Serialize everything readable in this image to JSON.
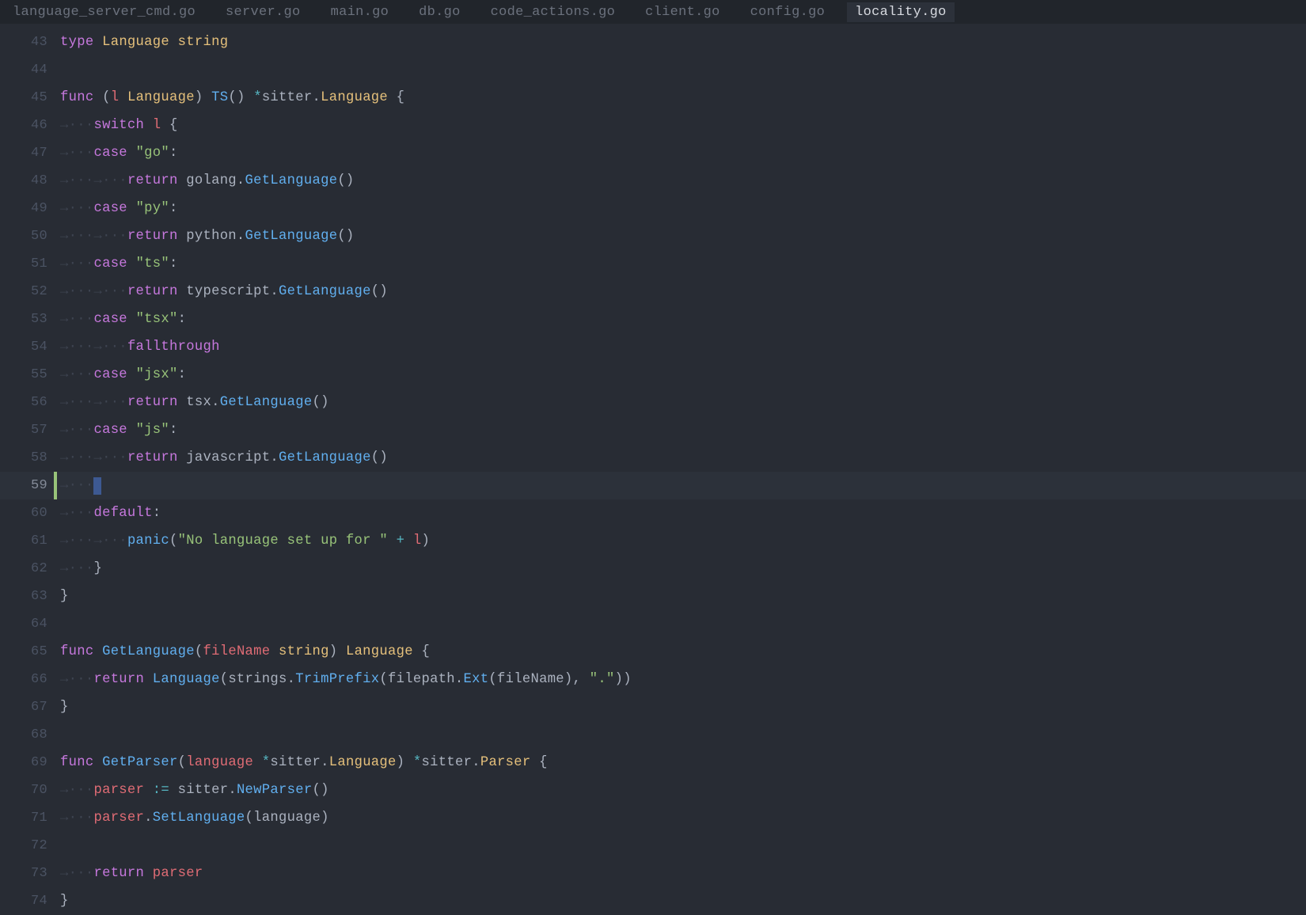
{
  "tabs": [
    {
      "label": "language_server_cmd.go",
      "active": false
    },
    {
      "label": "server.go",
      "active": false
    },
    {
      "label": "main.go",
      "active": false
    },
    {
      "label": "db.go",
      "active": false
    },
    {
      "label": "code_actions.go",
      "active": false
    },
    {
      "label": "client.go",
      "active": false
    },
    {
      "label": "config.go",
      "active": false
    },
    {
      "label": "locality.go",
      "active": true
    }
  ],
  "ws_arrow": "→",
  "ws_dot": "·",
  "lines": [
    {
      "n": 43,
      "mod": "",
      "ind": 0,
      "cur": false,
      "tokens": [
        [
          "kw",
          "type"
        ],
        [
          "pl",
          " "
        ],
        [
          "yl",
          "Language"
        ],
        [
          "pl",
          " "
        ],
        [
          "yl",
          "string"
        ]
      ]
    },
    {
      "n": 44,
      "mod": "",
      "ind": 0,
      "cur": false,
      "tokens": []
    },
    {
      "n": 45,
      "mod": "",
      "ind": 0,
      "cur": false,
      "tokens": [
        [
          "kw",
          "func"
        ],
        [
          "pl",
          " ("
        ],
        [
          "red",
          "l"
        ],
        [
          "pl",
          " "
        ],
        [
          "yl",
          "Language"
        ],
        [
          "pl",
          ") "
        ],
        [
          "fn",
          "TS"
        ],
        [
          "pl",
          "() "
        ],
        [
          "cy",
          "*"
        ],
        [
          "pl",
          "sitter."
        ],
        [
          "yl",
          "Language"
        ],
        [
          "pl",
          " {"
        ]
      ]
    },
    {
      "n": 46,
      "mod": "",
      "ind": 1,
      "cur": false,
      "tokens": [
        [
          "kw",
          "switch"
        ],
        [
          "pl",
          " "
        ],
        [
          "red",
          "l"
        ],
        [
          "pl",
          " {"
        ]
      ]
    },
    {
      "n": 47,
      "mod": "",
      "ind": 1,
      "cur": false,
      "tokens": [
        [
          "kw",
          "case"
        ],
        [
          "pl",
          " "
        ],
        [
          "gr",
          "\"go\""
        ],
        [
          "pl",
          ":"
        ]
      ]
    },
    {
      "n": 48,
      "mod": "",
      "ind": 2,
      "cur": false,
      "tokens": [
        [
          "kw",
          "return"
        ],
        [
          "pl",
          " golang."
        ],
        [
          "fn",
          "GetLanguage"
        ],
        [
          "pl",
          "()"
        ]
      ]
    },
    {
      "n": 49,
      "mod": "",
      "ind": 1,
      "cur": false,
      "tokens": [
        [
          "kw",
          "case"
        ],
        [
          "pl",
          " "
        ],
        [
          "gr",
          "\"py\""
        ],
        [
          "pl",
          ":"
        ]
      ]
    },
    {
      "n": 50,
      "mod": "",
      "ind": 2,
      "cur": false,
      "tokens": [
        [
          "kw",
          "return"
        ],
        [
          "pl",
          " python."
        ],
        [
          "fn",
          "GetLanguage"
        ],
        [
          "pl",
          "()"
        ]
      ]
    },
    {
      "n": 51,
      "mod": "",
      "ind": 1,
      "cur": false,
      "tokens": [
        [
          "kw",
          "case"
        ],
        [
          "pl",
          " "
        ],
        [
          "gr",
          "\"ts\""
        ],
        [
          "pl",
          ":"
        ]
      ]
    },
    {
      "n": 52,
      "mod": "",
      "ind": 2,
      "cur": false,
      "tokens": [
        [
          "kw",
          "return"
        ],
        [
          "pl",
          " typescript."
        ],
        [
          "fn",
          "GetLanguage"
        ],
        [
          "pl",
          "()"
        ]
      ]
    },
    {
      "n": 53,
      "mod": "",
      "ind": 1,
      "cur": false,
      "tokens": [
        [
          "kw",
          "case"
        ],
        [
          "pl",
          " "
        ],
        [
          "gr",
          "\"tsx\""
        ],
        [
          "pl",
          ":"
        ]
      ]
    },
    {
      "n": 54,
      "mod": "",
      "ind": 2,
      "cur": false,
      "tokens": [
        [
          "kw",
          "fallthrough"
        ]
      ]
    },
    {
      "n": 55,
      "mod": "",
      "ind": 1,
      "cur": false,
      "tokens": [
        [
          "kw",
          "case"
        ],
        [
          "pl",
          " "
        ],
        [
          "gr",
          "\"jsx\""
        ],
        [
          "pl",
          ":"
        ]
      ]
    },
    {
      "n": 56,
      "mod": "",
      "ind": 2,
      "cur": false,
      "tokens": [
        [
          "kw",
          "return"
        ],
        [
          "pl",
          " tsx."
        ],
        [
          "fn",
          "GetLanguage"
        ],
        [
          "pl",
          "()"
        ]
      ]
    },
    {
      "n": 57,
      "mod": "",
      "ind": 1,
      "cur": false,
      "tokens": [
        [
          "kw",
          "case"
        ],
        [
          "pl",
          " "
        ],
        [
          "gr",
          "\"js\""
        ],
        [
          "pl",
          ":"
        ]
      ]
    },
    {
      "n": 58,
      "mod": "",
      "ind": 2,
      "cur": false,
      "tokens": [
        [
          "kw",
          "return"
        ],
        [
          "pl",
          " javascript."
        ],
        [
          "fn",
          "GetLanguage"
        ],
        [
          "pl",
          "()"
        ]
      ]
    },
    {
      "n": 59,
      "mod": "added",
      "ind": 1,
      "cur": true,
      "cursor": true,
      "tokens": []
    },
    {
      "n": 60,
      "mod": "",
      "ind": 1,
      "cur": false,
      "tokens": [
        [
          "kw",
          "default"
        ],
        [
          "pl",
          ":"
        ]
      ]
    },
    {
      "n": 61,
      "mod": "",
      "ind": 2,
      "cur": false,
      "tokens": [
        [
          "fn",
          "panic"
        ],
        [
          "pl",
          "("
        ],
        [
          "gr",
          "\"No language set up for \""
        ],
        [
          "pl",
          " "
        ],
        [
          "cy",
          "+"
        ],
        [
          "pl",
          " "
        ],
        [
          "red",
          "l"
        ],
        [
          "pl",
          ")"
        ]
      ]
    },
    {
      "n": 62,
      "mod": "",
      "ind": 1,
      "cur": false,
      "tokens": [
        [
          "pl",
          "}"
        ]
      ]
    },
    {
      "n": 63,
      "mod": "",
      "ind": 0,
      "cur": false,
      "tokens": [
        [
          "pl",
          "}"
        ]
      ]
    },
    {
      "n": 64,
      "mod": "",
      "ind": 0,
      "cur": false,
      "tokens": []
    },
    {
      "n": 65,
      "mod": "",
      "ind": 0,
      "cur": false,
      "tokens": [
        [
          "kw",
          "func"
        ],
        [
          "pl",
          " "
        ],
        [
          "fn",
          "GetLanguage"
        ],
        [
          "pl",
          "("
        ],
        [
          "red",
          "fileName"
        ],
        [
          "pl",
          " "
        ],
        [
          "yl",
          "string"
        ],
        [
          "pl",
          ") "
        ],
        [
          "yl",
          "Language"
        ],
        [
          "pl",
          " {"
        ]
      ]
    },
    {
      "n": 66,
      "mod": "",
      "ind": 1,
      "cur": false,
      "tokens": [
        [
          "kw",
          "return"
        ],
        [
          "pl",
          " "
        ],
        [
          "fn",
          "Language"
        ],
        [
          "pl",
          "(strings."
        ],
        [
          "fn",
          "TrimPrefix"
        ],
        [
          "pl",
          "(filepath."
        ],
        [
          "fn",
          "Ext"
        ],
        [
          "pl",
          "(fileName), "
        ],
        [
          "gr",
          "\".\""
        ],
        [
          "pl",
          "))"
        ]
      ]
    },
    {
      "n": 67,
      "mod": "",
      "ind": 0,
      "cur": false,
      "tokens": [
        [
          "pl",
          "}"
        ]
      ]
    },
    {
      "n": 68,
      "mod": "",
      "ind": 0,
      "cur": false,
      "tokens": []
    },
    {
      "n": 69,
      "mod": "",
      "ind": 0,
      "cur": false,
      "tokens": [
        [
          "kw",
          "func"
        ],
        [
          "pl",
          " "
        ],
        [
          "fn",
          "GetParser"
        ],
        [
          "pl",
          "("
        ],
        [
          "red",
          "language"
        ],
        [
          "pl",
          " "
        ],
        [
          "cy",
          "*"
        ],
        [
          "pl",
          "sitter."
        ],
        [
          "yl",
          "Language"
        ],
        [
          "pl",
          ") "
        ],
        [
          "cy",
          "*"
        ],
        [
          "pl",
          "sitter."
        ],
        [
          "yl",
          "Parser"
        ],
        [
          "pl",
          " {"
        ]
      ]
    },
    {
      "n": 70,
      "mod": "",
      "ind": 1,
      "cur": false,
      "tokens": [
        [
          "red",
          "parser"
        ],
        [
          "pl",
          " "
        ],
        [
          "cy",
          ":="
        ],
        [
          "pl",
          " sitter."
        ],
        [
          "fn",
          "NewParser"
        ],
        [
          "pl",
          "()"
        ]
      ]
    },
    {
      "n": 71,
      "mod": "",
      "ind": 1,
      "cur": false,
      "tokens": [
        [
          "red",
          "parser"
        ],
        [
          "pl",
          "."
        ],
        [
          "fn",
          "SetLanguage"
        ],
        [
          "pl",
          "(language)"
        ]
      ]
    },
    {
      "n": 72,
      "mod": "",
      "ind": 0,
      "cur": false,
      "tokens": []
    },
    {
      "n": 73,
      "mod": "",
      "ind": 1,
      "cur": false,
      "tokens": [
        [
          "kw",
          "return"
        ],
        [
          "pl",
          " "
        ],
        [
          "red",
          "parser"
        ]
      ]
    },
    {
      "n": 74,
      "mod": "",
      "ind": 0,
      "cur": false,
      "tokens": [
        [
          "pl",
          "}"
        ]
      ]
    }
  ]
}
